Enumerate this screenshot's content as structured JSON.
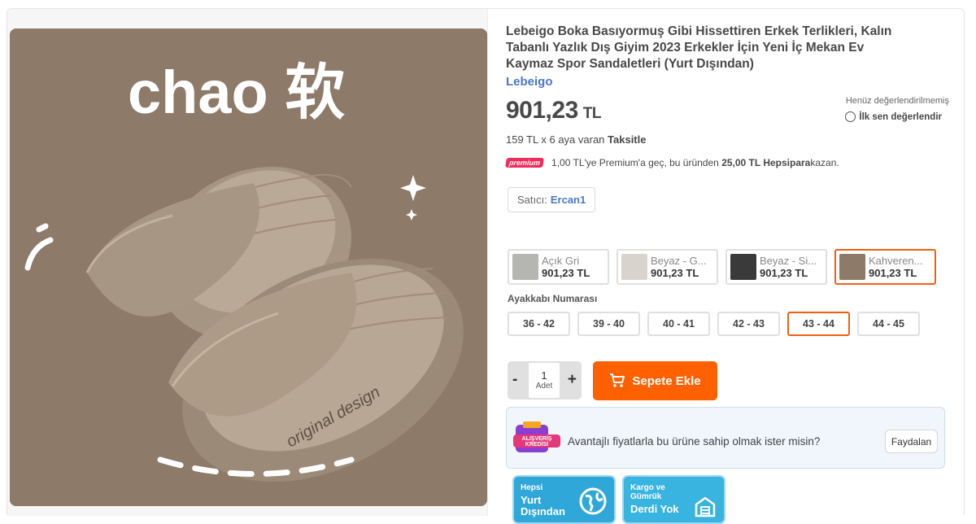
{
  "product": {
    "title": "Lebeigo Boka Basıyormuş Gibi Hissettiren Erkek Terlikleri, Kalın Tabanlı Yazlık Dış Giyim 2023 Erkekler İçin Yeni İç Mekan Ev Kaymaz Spor Sandaletleri (Yurt Dışından)",
    "brand": "Lebeigo",
    "price_value": "901,23",
    "price_currency": "TL",
    "installment_prefix": "159 TL x 6 aya varan ",
    "installment_strong": "Taksitle",
    "rating_status": "Henüz değerlendirilmemiş",
    "rate_link": "İlk sen değerlendir",
    "image_text": "chao 软",
    "image_engraving": "original design"
  },
  "premium": {
    "badge": "premium",
    "text_prefix": "1,00 TL'ye Premium'a geç, bu üründen ",
    "text_strong": "25,00 TL Hepsipara",
    "text_suffix": " kazan."
  },
  "seller": {
    "label": "Satıcı:",
    "name": "Ercan1"
  },
  "variants": [
    {
      "name": "Açık Gri",
      "price": "901,23 TL",
      "selected": false,
      "color": "#b5b5b2"
    },
    {
      "name": "Beyaz - G...",
      "price": "901,23 TL",
      "selected": false,
      "color": "#d8d4cd"
    },
    {
      "name": "Beyaz - Si...",
      "price": "901,23 TL",
      "selected": false,
      "color": "#3a3a3a"
    },
    {
      "name": "Kahveren...",
      "price": "901,23 TL",
      "selected": true,
      "color": "#8d7a68"
    }
  ],
  "size_label": "Ayakkabı Numarası",
  "sizes": [
    {
      "label": "36 - 42",
      "selected": false
    },
    {
      "label": "39 - 40",
      "selected": false
    },
    {
      "label": "40 - 41",
      "selected": false
    },
    {
      "label": "42 - 43",
      "selected": false
    },
    {
      "label": "43 - 44",
      "selected": true
    },
    {
      "label": "44 - 45",
      "selected": false
    }
  ],
  "quantity": {
    "minus": "-",
    "plus": "+",
    "value": "1",
    "unit": "Adet"
  },
  "cart_button": "Sepete Ekle",
  "credit": {
    "logo_line1": "ALIŞVERİŞ",
    "logo_line2": "KREDİSİ",
    "text": "Avantajlı fiyatlarla bu ürüne sahip olmak ister misin?",
    "button": "Faydalan"
  },
  "badges": [
    {
      "small": "Hepsi",
      "big1": "Yurt",
      "big2": "Dışından"
    },
    {
      "small1": "Kargo ve",
      "small2": "Gümrük",
      "big": "Derdi Yok"
    }
  ],
  "colors": {
    "accent_orange": "#ff6000",
    "selected_border": "#f06010",
    "link_blue": "#4a78c8",
    "premium_pink": "#ef2c5c",
    "image_background": "#8d7a68"
  }
}
